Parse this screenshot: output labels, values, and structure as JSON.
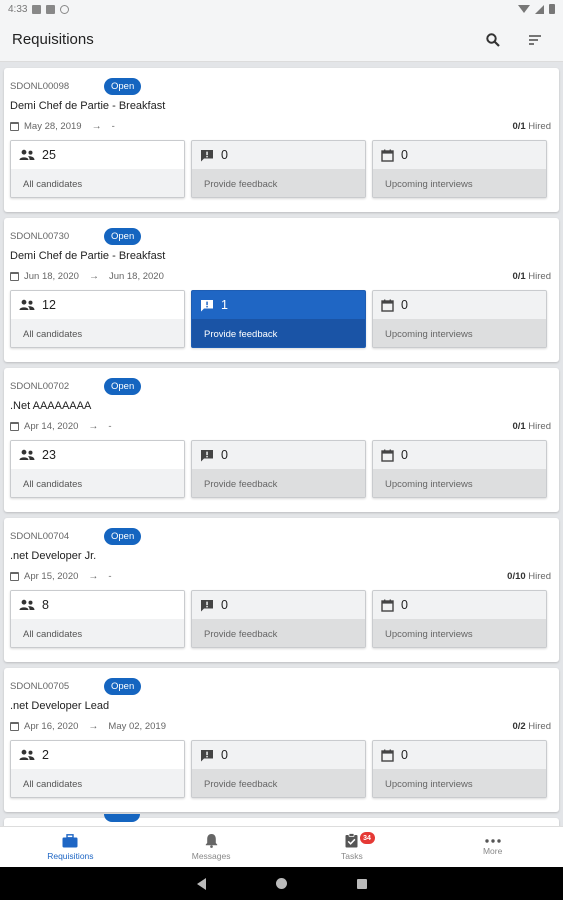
{
  "status_bar": {
    "time": "4:33"
  },
  "app_bar": {
    "title": "Requisitions",
    "search_icon": "search-icon",
    "sort_icon": "sort-icon"
  },
  "requisitions": [
    {
      "id": "SDONL00098",
      "status": "Open",
      "title": "Demi Chef de Partie - Breakfast",
      "start_date": "May 28, 2019",
      "end_date": "-",
      "hired_count": "0/1",
      "hired_label": "Hired",
      "tiles": {
        "candidates": {
          "count": "25",
          "label": "All candidates"
        },
        "feedback": {
          "count": "0",
          "label": "Provide feedback"
        },
        "interviews": {
          "count": "0",
          "label": "Upcoming interviews"
        }
      }
    },
    {
      "id": "SDONL00730",
      "status": "Open",
      "title": "Demi Chef de Partie - Breakfast",
      "start_date": "Jun 18, 2020",
      "end_date": "Jun 18, 2020",
      "hired_count": "0/1",
      "hired_label": "Hired",
      "tiles": {
        "candidates": {
          "count": "12",
          "label": "All candidates"
        },
        "feedback": {
          "count": "1",
          "label": "Provide feedback"
        },
        "interviews": {
          "count": "0",
          "label": "Upcoming interviews"
        }
      }
    },
    {
      "id": "SDONL00702",
      "status": "Open",
      "title": ".Net AAAAAAAA",
      "start_date": "Apr 14, 2020",
      "end_date": "-",
      "hired_count": "0/1",
      "hired_label": "Hired",
      "tiles": {
        "candidates": {
          "count": "23",
          "label": "All candidates"
        },
        "feedback": {
          "count": "0",
          "label": "Provide feedback"
        },
        "interviews": {
          "count": "0",
          "label": "Upcoming interviews"
        }
      }
    },
    {
      "id": "SDONL00704",
      "status": "Open",
      "title": ".net Developer Jr.",
      "start_date": "Apr 15, 2020",
      "end_date": "-",
      "hired_count": "0/10",
      "hired_label": "Hired",
      "tiles": {
        "candidates": {
          "count": "8",
          "label": "All candidates"
        },
        "feedback": {
          "count": "0",
          "label": "Provide feedback"
        },
        "interviews": {
          "count": "0",
          "label": "Upcoming interviews"
        }
      }
    },
    {
      "id": "SDONL00705",
      "status": "Open",
      "title": ".net Developer Lead",
      "start_date": "Apr 16, 2020",
      "end_date": "May 02, 2019",
      "hired_count": "0/2",
      "hired_label": "Hired",
      "tiles": {
        "candidates": {
          "count": "2",
          "label": "All candidates"
        },
        "feedback": {
          "count": "0",
          "label": "Provide feedback"
        },
        "interviews": {
          "count": "0",
          "label": "Upcoming interviews"
        }
      }
    }
  ],
  "bottom_nav": {
    "items": [
      {
        "label": "Requisitions",
        "icon": "briefcase-icon"
      },
      {
        "label": "Messages",
        "icon": "bell-icon"
      },
      {
        "label": "Tasks",
        "icon": "clipboard-check-icon",
        "badge": "34"
      },
      {
        "label": "More",
        "icon": "more-horiz-icon"
      }
    ]
  },
  "colors": {
    "accent": "#1e66c4",
    "badge": "#1565c0",
    "notification": "#e53935"
  }
}
